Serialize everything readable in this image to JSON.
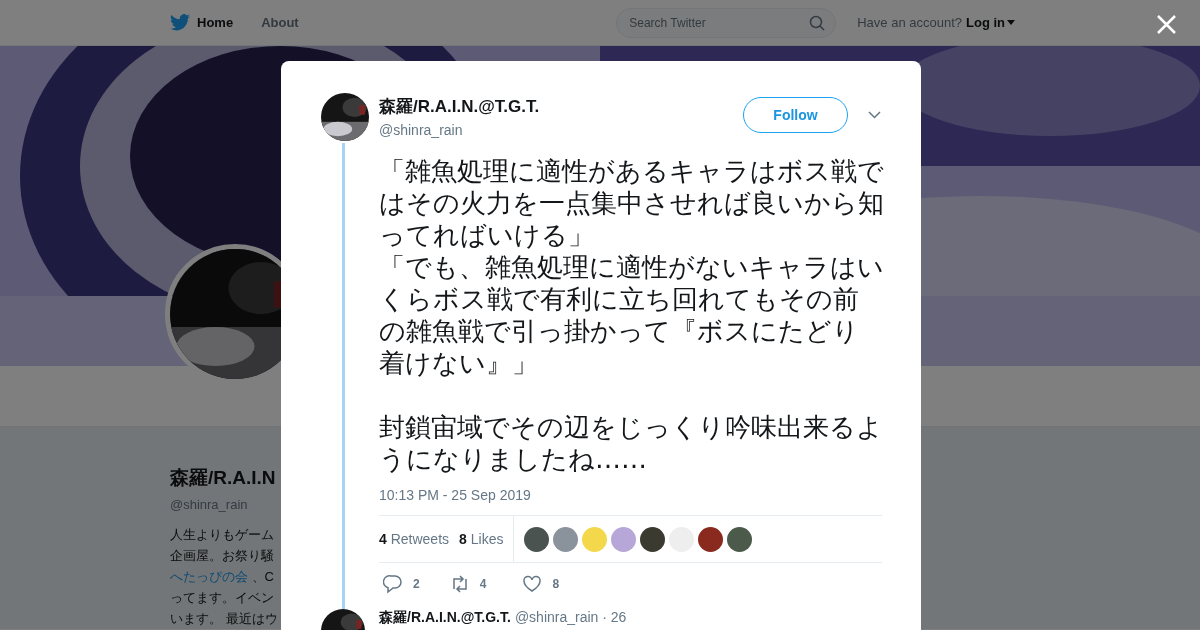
{
  "nav": {
    "items": [
      {
        "label": "Home",
        "selected": true
      },
      {
        "label": "About",
        "selected": false
      }
    ],
    "search": {
      "placeholder": "Search Twitter"
    },
    "account_prompt": "Have an account?",
    "login": "Log in"
  },
  "profile": {
    "name": "森羅/R.A.I.N",
    "handle": "@shinra_rain",
    "bio_lines": [
      {
        "text": "人生よりもゲーム",
        "kind": "text"
      },
      {
        "text": "企画屋。お祭り騒",
        "kind": "text"
      },
      {
        "text": "へたっぴの会",
        "kind": "link",
        "after": " 、C"
      },
      {
        "text": "ってます。イベン",
        "kind": "text"
      },
      {
        "text": "います。 最近はウ",
        "kind": "text"
      }
    ]
  },
  "tweet": {
    "name": "森羅/R.A.I.N.@T.G.T.",
    "handle": "@shinra_rain",
    "follow": "Follow",
    "paragraphs": [
      [
        "「雑魚処理に適性があるキャラはボス戦ではその火力を一点集中させれば良いから知ってればいける」",
        "「でも、雑魚処理に適性がないキャラはいくらボス戦で有利に立ち回れてもその前の雑魚戦で引っ掛かって『ボスにたどり着けない』」"
      ],
      [
        "封鎖宙域でその辺をじっくり吟味出来るようになりましたね……"
      ]
    ],
    "time": "10:13 PM - 25 Sep 2019",
    "stats": [
      {
        "count": "4",
        "label": "Retweets"
      },
      {
        "count": "8",
        "label": "Likes"
      }
    ],
    "likers": [
      {
        "color": "#4a5350"
      },
      {
        "color": "#8a929c"
      },
      {
        "color": "#f2d84a"
      },
      {
        "color": "#b7a6d8"
      },
      {
        "color": "#3b3a30"
      },
      {
        "color": "#eeeeee"
      },
      {
        "color": "#8a2a1e"
      },
      {
        "color": "#4b5a4a"
      }
    ],
    "actions": [
      {
        "kind": "reply",
        "count": "2"
      },
      {
        "kind": "retweet",
        "count": "4"
      },
      {
        "kind": "like",
        "count": "8"
      }
    ]
  },
  "next_tweet": {
    "name": "森羅/R.A.I.N.@T.G.T.",
    "handle": "@shinra_rain · 26"
  }
}
